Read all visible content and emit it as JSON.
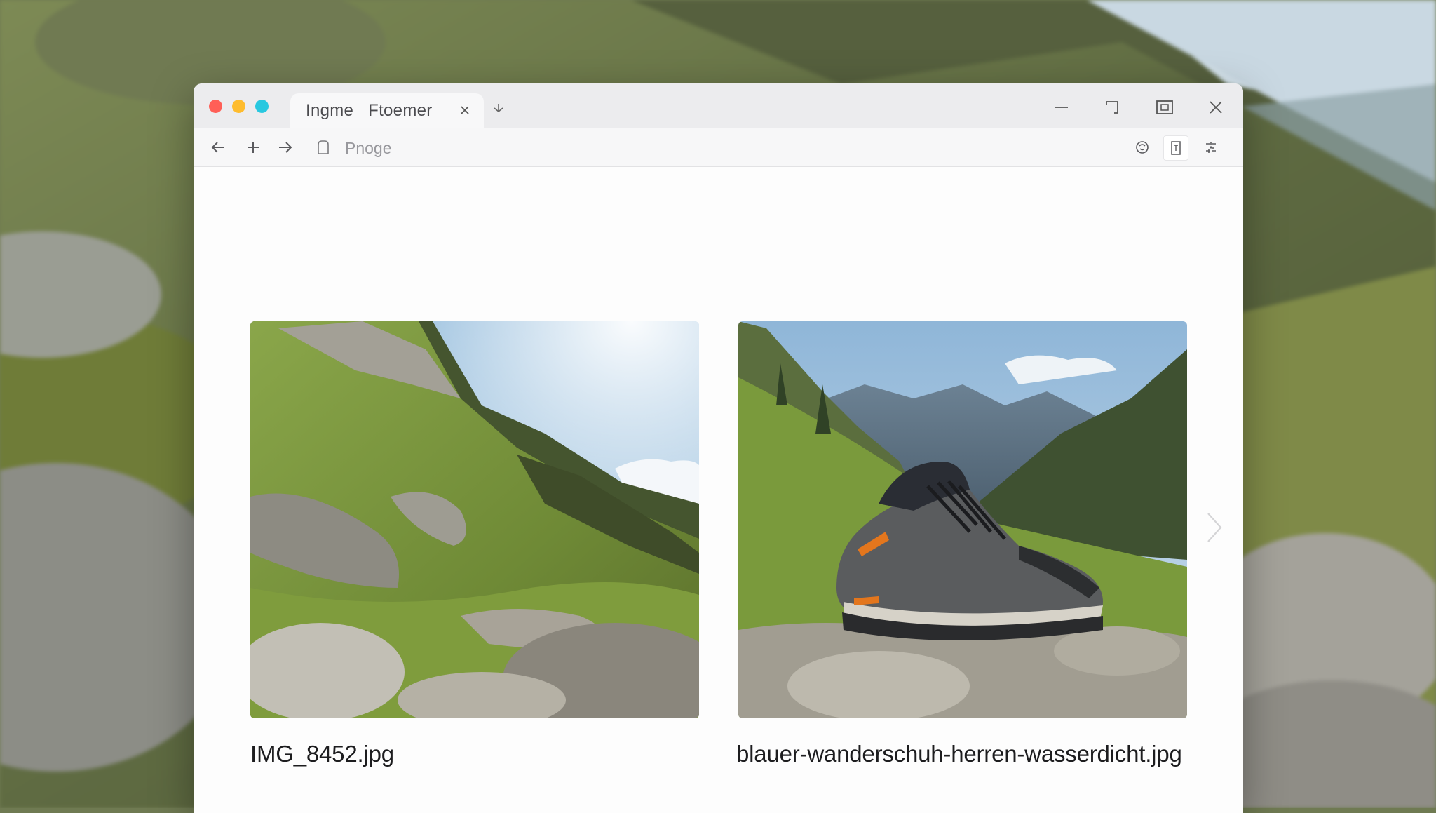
{
  "window": {
    "tab_title": "Ingme   Ftoemer",
    "tab_close_icon": "close-icon",
    "new_tab_icon": "down-arrow-icon"
  },
  "window_controls": [
    "minimize-icon",
    "maximize-icon",
    "tile-icon",
    "close-icon"
  ],
  "toolbar": {
    "back_icon": "arrow-left-icon",
    "add_icon": "plus-icon",
    "forward_icon": "arrow-right-icon",
    "page_icon": "page-icon",
    "address_placeholder": "Pnoge",
    "right_icons": [
      "shield-icon",
      "reader-icon",
      "extensions-icon"
    ]
  },
  "gallery": {
    "items": [
      {
        "filename": "IMG_8452.jpg",
        "image": "mountain-hillside-photo"
      },
      {
        "filename": "blauer-wanderschuh-herren-wasserdicht.jpg",
        "image": "hiking-shoe-photo"
      }
    ],
    "next_icon": "chevron-right-icon"
  }
}
